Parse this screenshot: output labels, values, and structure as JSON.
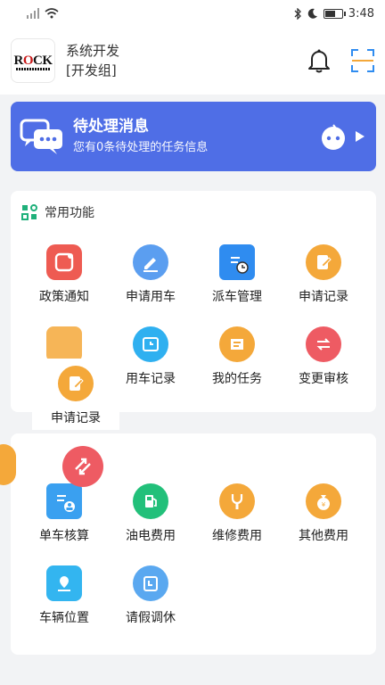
{
  "status_bar": {
    "time": "3:48"
  },
  "header": {
    "logo_text_r": "R",
    "logo_text_o": "O",
    "logo_text_ck": "CK",
    "org_name": "系统开发",
    "org_group": "[开发组]"
  },
  "banner": {
    "title": "待处理消息",
    "subtitle": "您有0条待处理的任务信息",
    "color": "#4f6ee6"
  },
  "section1": {
    "title": "常用功能",
    "items": [
      {
        "label": "政策通知",
        "icon": "policy-notice-icon",
        "color": "#ee5b52"
      },
      {
        "label": "申请用车",
        "icon": "apply-car-icon",
        "color": "#5b9ef0"
      },
      {
        "label": "派车管理",
        "icon": "dispatch-manage-icon",
        "color": "#2f8cf0"
      },
      {
        "label": "申请记录",
        "icon": "apply-record-icon",
        "color": "#f4a83a"
      },
      {
        "label": "用车记录",
        "icon": "car-record-icon",
        "color": "#2fb0f0"
      },
      {
        "label": "我的任务",
        "icon": "my-task-icon",
        "color": "#f4a83a"
      },
      {
        "label": "变更审核",
        "icon": "change-review-icon",
        "color": "#ee5b63"
      }
    ],
    "ghost_label": "申请记录"
  },
  "section2": {
    "items": [
      {
        "label": "单车核算",
        "icon": "car-accounting-icon",
        "color": "#3aa0f0"
      },
      {
        "label": "油电费用",
        "icon": "fuel-cost-icon",
        "color": "#22c07a"
      },
      {
        "label": "维修费用",
        "icon": "repair-cost-icon",
        "color": "#f4a83a"
      },
      {
        "label": "其他费用",
        "icon": "other-cost-icon",
        "color": "#f4a83a"
      },
      {
        "label": "车辆位置",
        "icon": "vehicle-location-icon",
        "color": "#33b5f0"
      },
      {
        "label": "请假调休",
        "icon": "leave-icon",
        "color": "#5aa8f0"
      }
    ]
  }
}
